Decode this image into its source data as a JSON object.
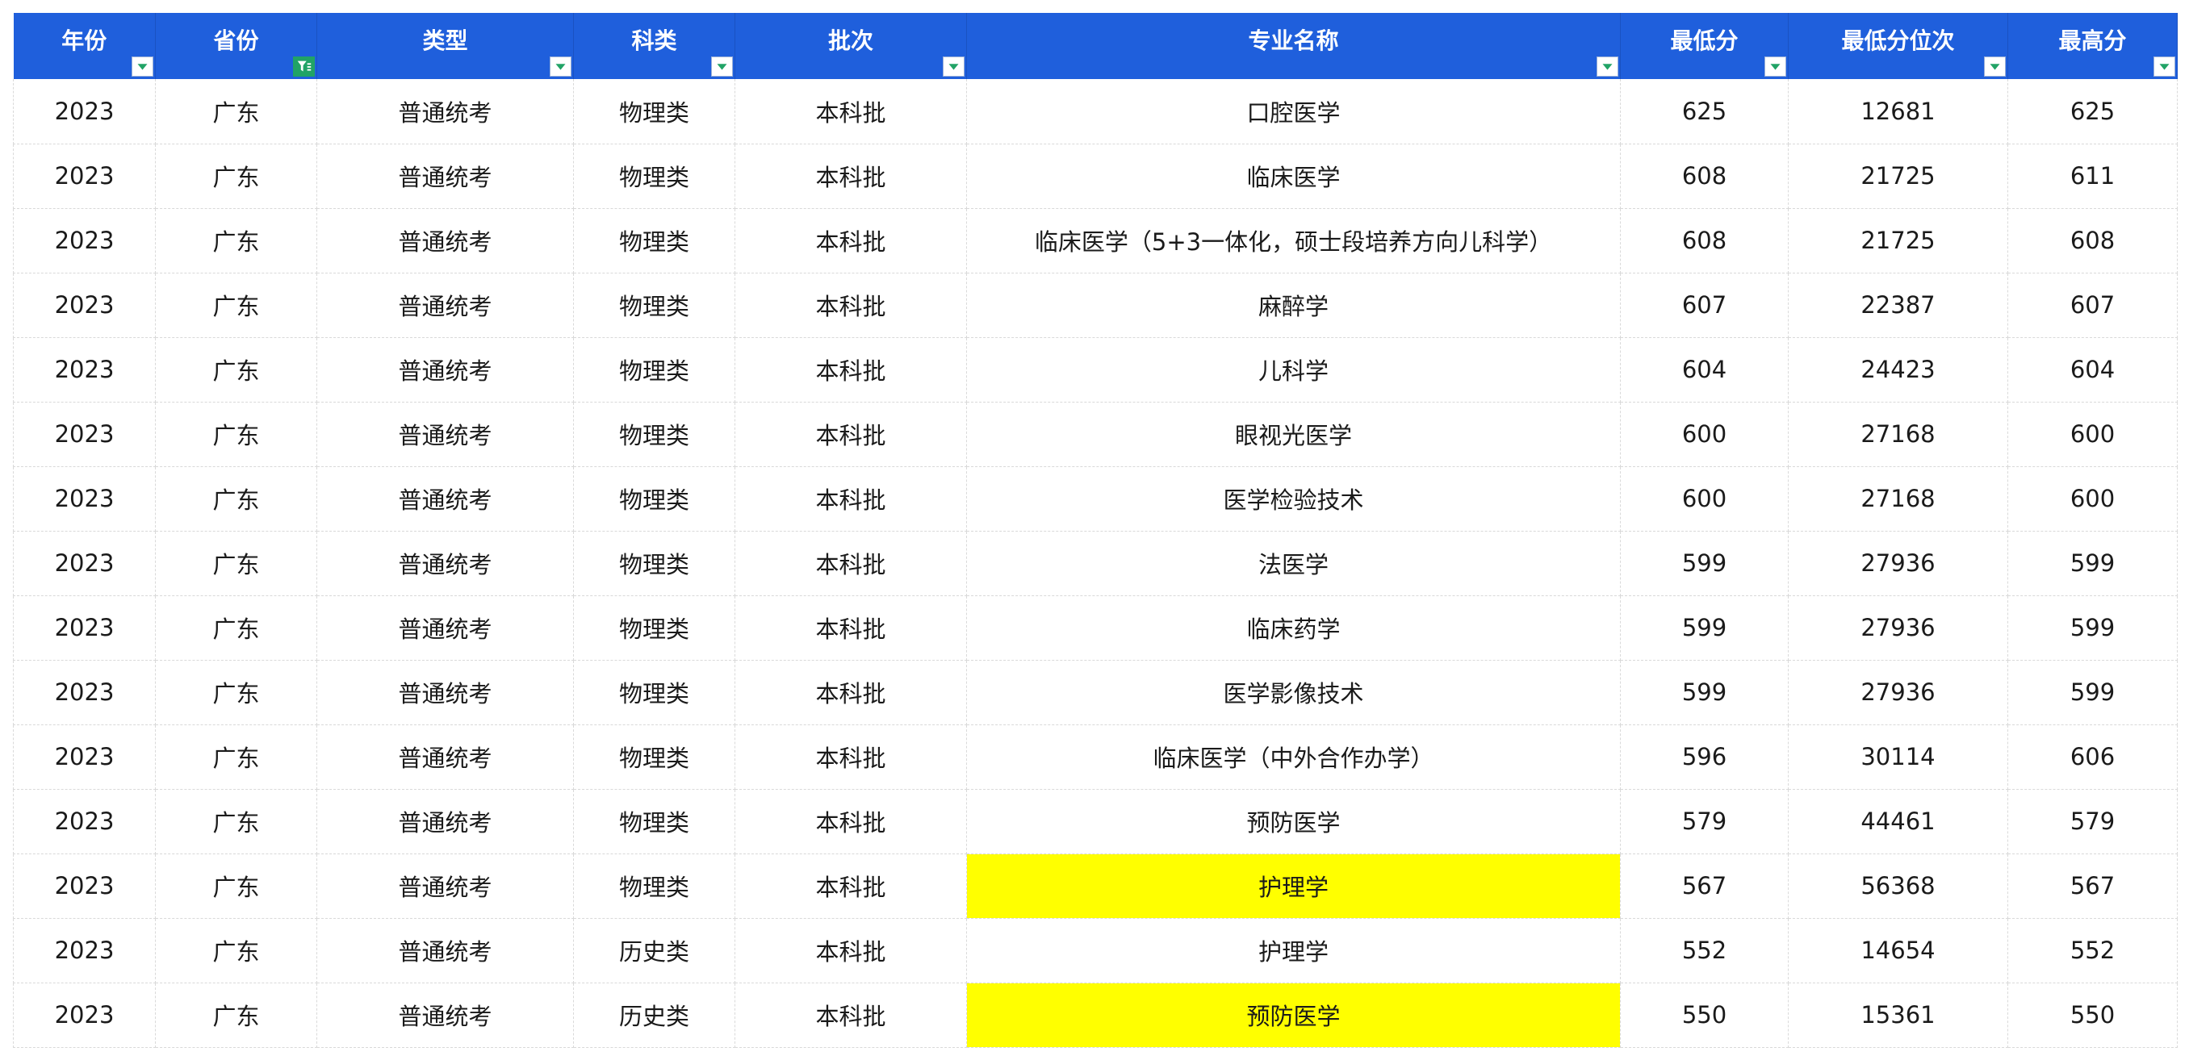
{
  "columns": [
    {
      "label": "年份",
      "filter_active": false
    },
    {
      "label": "省份",
      "filter_active": true
    },
    {
      "label": "类型",
      "filter_active": false
    },
    {
      "label": "科类",
      "filter_active": false
    },
    {
      "label": "批次",
      "filter_active": false
    },
    {
      "label": "专业名称",
      "filter_active": false
    },
    {
      "label": "最低分",
      "filter_active": false
    },
    {
      "label": "最低分位次",
      "filter_active": false
    },
    {
      "label": "最高分",
      "filter_active": false
    }
  ],
  "highlight_color": "#ffff00",
  "header_color": "#1f5fdc",
  "filter_icon_color": "#21a366",
  "rows": [
    {
      "cells": [
        "2023",
        "广东",
        "普通统考",
        "物理类",
        "本科批",
        "口腔医学",
        "625",
        "12681",
        "625"
      ],
      "highlight": false
    },
    {
      "cells": [
        "2023",
        "广东",
        "普通统考",
        "物理类",
        "本科批",
        "临床医学",
        "608",
        "21725",
        "611"
      ],
      "highlight": false
    },
    {
      "cells": [
        "2023",
        "广东",
        "普通统考",
        "物理类",
        "本科批",
        "临床医学（5+3一体化，硕士段培养方向儿科学）",
        "608",
        "21725",
        "608"
      ],
      "highlight": false
    },
    {
      "cells": [
        "2023",
        "广东",
        "普通统考",
        "物理类",
        "本科批",
        "麻醉学",
        "607",
        "22387",
        "607"
      ],
      "highlight": false
    },
    {
      "cells": [
        "2023",
        "广东",
        "普通统考",
        "物理类",
        "本科批",
        "儿科学",
        "604",
        "24423",
        "604"
      ],
      "highlight": false
    },
    {
      "cells": [
        "2023",
        "广东",
        "普通统考",
        "物理类",
        "本科批",
        "眼视光医学",
        "600",
        "27168",
        "600"
      ],
      "highlight": false
    },
    {
      "cells": [
        "2023",
        "广东",
        "普通统考",
        "物理类",
        "本科批",
        "医学检验技术",
        "600",
        "27168",
        "600"
      ],
      "highlight": false
    },
    {
      "cells": [
        "2023",
        "广东",
        "普通统考",
        "物理类",
        "本科批",
        "法医学",
        "599",
        "27936",
        "599"
      ],
      "highlight": false
    },
    {
      "cells": [
        "2023",
        "广东",
        "普通统考",
        "物理类",
        "本科批",
        "临床药学",
        "599",
        "27936",
        "599"
      ],
      "highlight": false
    },
    {
      "cells": [
        "2023",
        "广东",
        "普通统考",
        "物理类",
        "本科批",
        "医学影像技术",
        "599",
        "27936",
        "599"
      ],
      "highlight": false
    },
    {
      "cells": [
        "2023",
        "广东",
        "普通统考",
        "物理类",
        "本科批",
        "临床医学（中外合作办学）",
        "596",
        "30114",
        "606"
      ],
      "highlight": false
    },
    {
      "cells": [
        "2023",
        "广东",
        "普通统考",
        "物理类",
        "本科批",
        "预防医学",
        "579",
        "44461",
        "579"
      ],
      "highlight": false
    },
    {
      "cells": [
        "2023",
        "广东",
        "普通统考",
        "物理类",
        "本科批",
        "护理学",
        "567",
        "56368",
        "567"
      ],
      "highlight": true
    },
    {
      "cells": [
        "2023",
        "广东",
        "普通统考",
        "历史类",
        "本科批",
        "护理学",
        "552",
        "14654",
        "552"
      ],
      "highlight": false
    },
    {
      "cells": [
        "2023",
        "广东",
        "普通统考",
        "历史类",
        "本科批",
        "预防医学",
        "550",
        "15361",
        "550"
      ],
      "highlight": true
    }
  ]
}
